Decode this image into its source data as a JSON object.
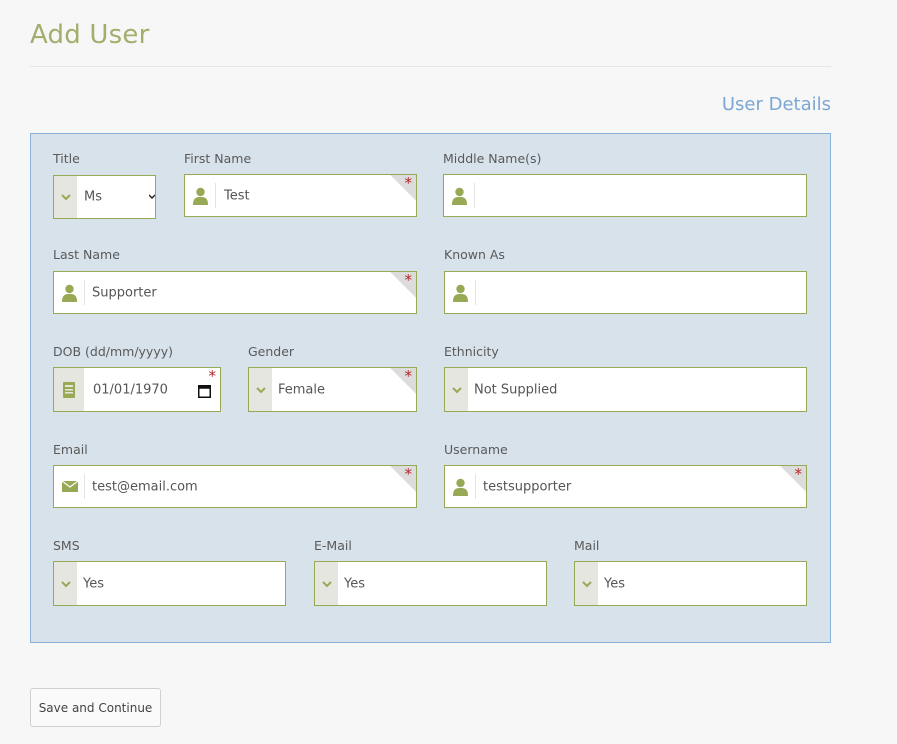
{
  "page": {
    "title": "Add User"
  },
  "section": {
    "title": "User Details"
  },
  "form": {
    "title": {
      "label": "Title",
      "value": "Ms"
    },
    "first_name": {
      "label": "First Name",
      "value": "Test",
      "required": "*"
    },
    "middle_names": {
      "label": "Middle Name(s)",
      "value": ""
    },
    "last_name": {
      "label": "Last Name",
      "value": "Supporter",
      "required": "*"
    },
    "known_as": {
      "label": "Known As",
      "value": ""
    },
    "dob": {
      "label": "DOB (dd/mm/yyyy)",
      "value": "01/01/1970",
      "required": "*"
    },
    "gender": {
      "label": "Gender",
      "value": "Female",
      "required": "*"
    },
    "ethnicity": {
      "label": "Ethnicity",
      "value": "Not Supplied"
    },
    "email": {
      "label": "Email",
      "value": "test@email.com",
      "required": "*"
    },
    "username": {
      "label": "Username",
      "value": "testsupporter",
      "required": "*"
    },
    "sms": {
      "label": "SMS",
      "value": "Yes"
    },
    "email_pref": {
      "label": "E-Mail",
      "value": "Yes"
    },
    "mail": {
      "label": "Mail",
      "value": "Yes"
    }
  },
  "actions": {
    "save_label": "Save and Continue"
  },
  "icons": {
    "person": "person-icon",
    "calendar": "calendar-icon",
    "envelope": "envelope-icon",
    "chevron": "chevron-down-icon"
  },
  "colors": {
    "accent_olive": "#98a956",
    "title_olive": "#a3ae6d",
    "section_blue": "#7ba7d3",
    "panel_bg": "#d8e2ea",
    "panel_border": "#89b2d8",
    "required_red": "#b52525"
  }
}
